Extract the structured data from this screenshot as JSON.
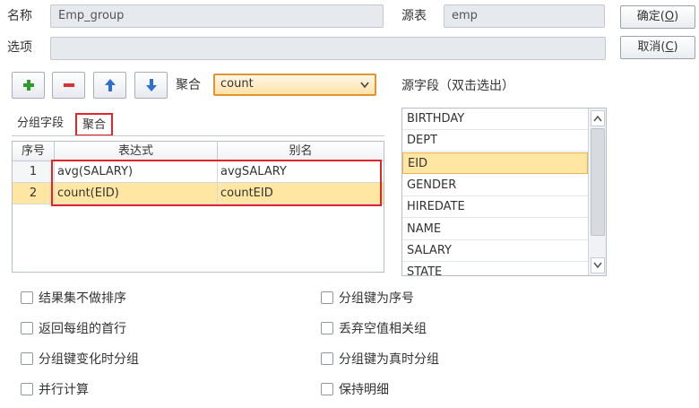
{
  "form": {
    "name_label": "名称",
    "name_value": "Emp_group",
    "source_label": "源表",
    "source_value": "emp",
    "options_label": "选项",
    "options_value": ""
  },
  "buttons": {
    "ok_label": "确定(",
    "ok_key": "O",
    "ok_suffix": ")",
    "cancel_label": "取消(",
    "cancel_key": "C",
    "cancel_suffix": ")"
  },
  "toolbar": {
    "agg_label": "聚合",
    "agg_selected": "count"
  },
  "source_fields_label": "源字段（双击选出）",
  "tabs": [
    {
      "label": "分组字段",
      "active": false
    },
    {
      "label": "聚合",
      "active": true
    }
  ],
  "grid": {
    "headers": [
      "序号",
      "表达式",
      "别名"
    ],
    "rows": [
      {
        "num": "1",
        "expr": "avg(SALARY)",
        "alias": "avgSALARY",
        "selected": false
      },
      {
        "num": "2",
        "expr": "count(EID)",
        "alias": "countEID",
        "selected": true
      }
    ]
  },
  "source_fields": [
    "BIRTHDAY",
    "DEPT",
    "EID",
    "GENDER",
    "HIREDATE",
    "NAME",
    "SALARY",
    "STATE"
  ],
  "selected_field": "EID",
  "checkboxes_left": [
    "结果集不做排序",
    "返回每组的首行",
    "分组键变化时分组",
    "并行计算"
  ],
  "checkboxes_right": [
    "分组键为序号",
    "丢弃空值相关组",
    "分组键为真时分组",
    "保持明细"
  ],
  "colors": {
    "highlight_row": "#ffe7a3",
    "annotation_red": "#e0252b",
    "combo_border": "#e0962e"
  }
}
